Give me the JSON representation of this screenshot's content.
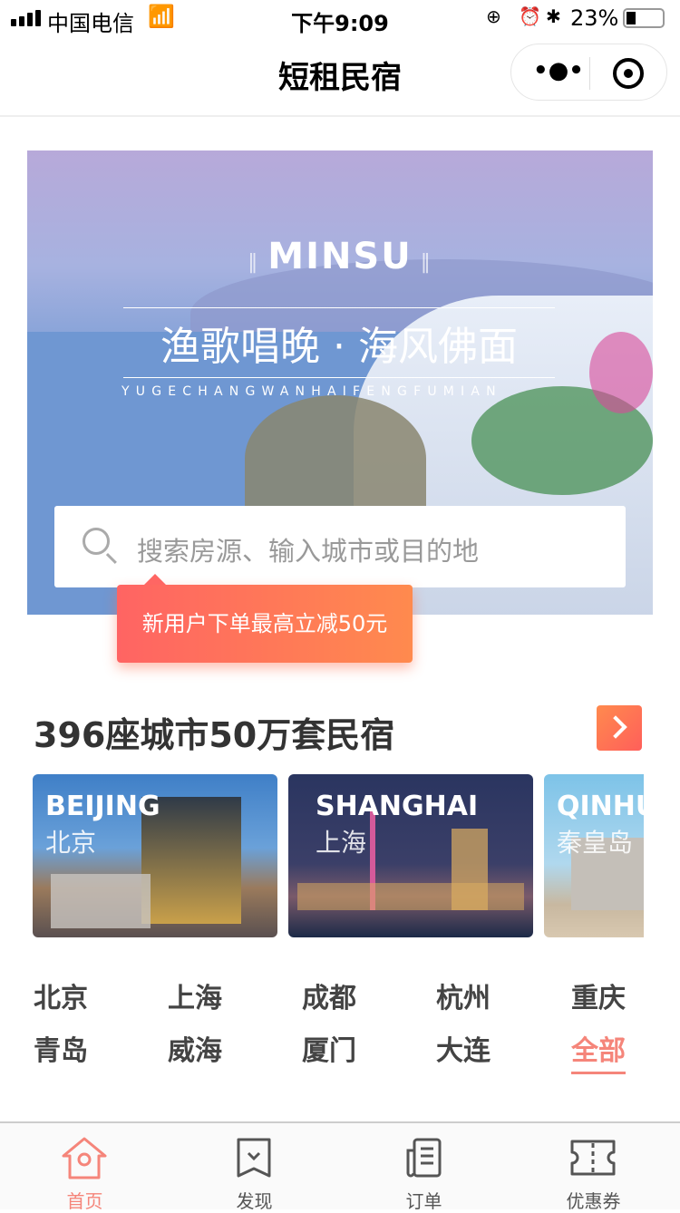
{
  "status_bar": {
    "carrier": "中国电信",
    "time": "下午9:09",
    "battery": "23%"
  },
  "nav": {
    "title": "短租民宿"
  },
  "banner": {
    "brand": "MINSU",
    "slogan": "渔歌唱晚 · 海风佛面",
    "pinyin": "YUGECHANGWANHAIFENGFUMIAN"
  },
  "search": {
    "placeholder": "搜索房源、输入城市或目的地"
  },
  "promo": {
    "text": "新用户下单最高立减50元"
  },
  "section": {
    "title": "396座城市50万套民宿"
  },
  "cards": [
    {
      "en": "BEIJING",
      "cn": "北京"
    },
    {
      "en": "SHANGHAI",
      "cn": "上海"
    },
    {
      "en": "QINHUANGDAO",
      "cn": "秦皇岛"
    }
  ],
  "cities": [
    "北京",
    "上海",
    "成都",
    "杭州",
    "重庆",
    "青岛",
    "威海",
    "厦门",
    "大连",
    "全部"
  ],
  "tabs": [
    {
      "label": "首页"
    },
    {
      "label": "发现"
    },
    {
      "label": "订单"
    },
    {
      "label": "优惠券"
    }
  ],
  "colors": {
    "accent": "#f5857a",
    "promo_start": "#ff6463",
    "promo_end": "#ff8a4e"
  }
}
